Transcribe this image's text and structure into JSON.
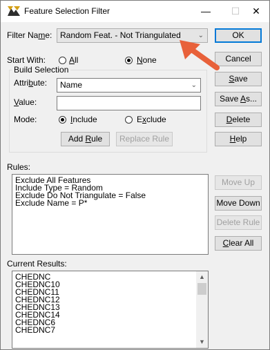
{
  "window": {
    "title": "Feature Selection Filter",
    "controls": {
      "minimize": "—",
      "maximize": "☐",
      "close": "✕"
    }
  },
  "filter_name": {
    "label_pre": "Filter Na",
    "label_ul": "m",
    "label_post": "e:",
    "value": "Random Feat. - Not Triangulated"
  },
  "start_with": {
    "label": "Start With:",
    "option_all_ul": "A",
    "option_all_rest": "ll",
    "option_none_ul": "N",
    "option_none_rest": "one",
    "selected": "None"
  },
  "build_selection": {
    "legend": "Build Selection",
    "attribute_label_pre": "Attri",
    "attribute_label_ul": "b",
    "attribute_label_post": "ute:",
    "attribute_value": "Name",
    "value_label_ul": "V",
    "value_label_post": "alue:",
    "value_text": "",
    "mode_label": "Mode:",
    "include_ul": "I",
    "include_rest": "nclude",
    "exclude_pre": "E",
    "exclude_ul": "x",
    "exclude_rest": "clude",
    "mode_selected": "Include",
    "add_rule_pre": "Add ",
    "add_rule_ul": "R",
    "add_rule_post": "ule",
    "replace_rule": "Replace Rule"
  },
  "buttons": {
    "ok": "OK",
    "cancel": "Cancel",
    "save_ul": "S",
    "save_rest": "ave",
    "save_as_pre": "Save ",
    "save_as_ul": "A",
    "save_as_post": "s...",
    "delete_ul": "D",
    "delete_rest": "elete",
    "help_ul": "H",
    "help_rest": "elp"
  },
  "rules": {
    "label": "Rules:",
    "items": [
      "Exclude All Features",
      "Include Type = Random",
      "Exclude Do Not Triangulate = False",
      "Exclude Name = P*"
    ],
    "move_up": "Move Up",
    "move_down": "Move Down",
    "delete_rule": "Delete Rule",
    "clear_all_ul": "C",
    "clear_all_rest": "lear All"
  },
  "results": {
    "label": "Current Results:",
    "items": [
      "CHEDNC",
      "CHEDNC10",
      "CHEDNC11",
      "CHEDNC12",
      "CHEDNC13",
      "CHEDNC14",
      "CHEDNC6",
      "CHEDNC7"
    ]
  },
  "colors": {
    "annotation_arrow": "#e8613a",
    "accent": "#0078d7"
  }
}
